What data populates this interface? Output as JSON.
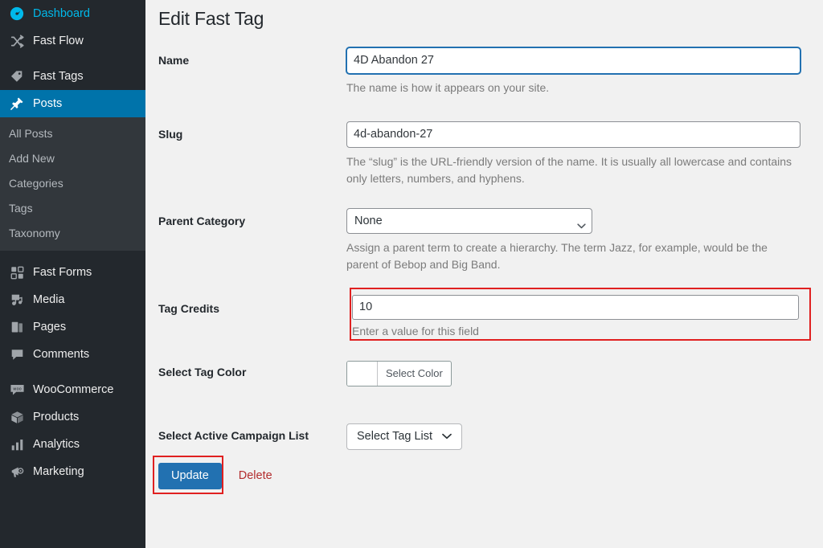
{
  "sidebar": {
    "items": [
      {
        "label": "Dashboard",
        "icon": "dashboard-icon",
        "state": "hovered",
        "gap_after": false
      },
      {
        "label": "Fast Flow",
        "icon": "shuffle-icon",
        "state": "normal",
        "gap_after": true
      },
      {
        "label": "Fast Tags",
        "icon": "tag-icon",
        "state": "normal",
        "gap_after": false
      },
      {
        "label": "Posts",
        "icon": "pin-icon",
        "state": "current",
        "gap_after": false
      }
    ],
    "submenu": {
      "parent": "Posts",
      "items": [
        "All Posts",
        "Add New",
        "Categories",
        "Tags",
        "Taxonomy"
      ]
    },
    "items_after": [
      {
        "label": "Fast Forms",
        "icon": "forms-grid-icon",
        "state": "normal",
        "gap_after": false
      },
      {
        "label": "Media",
        "icon": "media-icon",
        "state": "normal",
        "gap_after": false
      },
      {
        "label": "Pages",
        "icon": "pages-icon",
        "state": "normal",
        "gap_after": false
      },
      {
        "label": "Comments",
        "icon": "comment-icon",
        "state": "normal",
        "gap_after": true
      },
      {
        "label": "WooCommerce",
        "icon": "woo-icon",
        "state": "normal",
        "gap_after": false
      },
      {
        "label": "Products",
        "icon": "box-icon",
        "state": "normal",
        "gap_after": false
      },
      {
        "label": "Analytics",
        "icon": "bar-chart-icon",
        "state": "normal",
        "gap_after": false
      },
      {
        "label": "Marketing",
        "icon": "megaphone-icon",
        "state": "normal",
        "gap_after": false
      }
    ],
    "colors": {
      "background": "#23282d",
      "submenu_background": "#32373c",
      "current_background": "#0073aa",
      "hover_text": "#00b9eb"
    }
  },
  "page": {
    "title": "Edit Fast Tag"
  },
  "form": {
    "name": {
      "label": "Name",
      "value": "4D Abandon 27",
      "placeholder": "",
      "help": "The name is how it appears on your site.",
      "focused": true
    },
    "slug": {
      "label": "Slug",
      "value": "4d-abandon-27",
      "placeholder": "",
      "help": "The “slug” is the URL-friendly version of the name. It is usually all lowercase and contains only letters, numbers, and hyphens."
    },
    "parent_category": {
      "label": "Parent Category",
      "selected": "None",
      "options": [
        "None"
      ],
      "help": "Assign a parent term to create a hierarchy. The term Jazz, for example, would be the parent of Bebop and Big Band."
    },
    "tag_credits": {
      "label": "Tag Credits",
      "value": "10",
      "placeholder": "",
      "help": "Enter a value for this field",
      "highlighted": true
    },
    "tag_color": {
      "label": "Select Tag Color",
      "button_label": "Select Color",
      "swatch_color": "#ffffff"
    },
    "campaign_list": {
      "label": "Select Active Campaign List",
      "selected": "Select Tag List",
      "options": [
        "Select Tag List"
      ]
    }
  },
  "actions": {
    "update_label": "Update",
    "delete_label": "Delete",
    "update_highlighted": true
  },
  "annotations": {
    "highlight_color": "#e02020"
  }
}
